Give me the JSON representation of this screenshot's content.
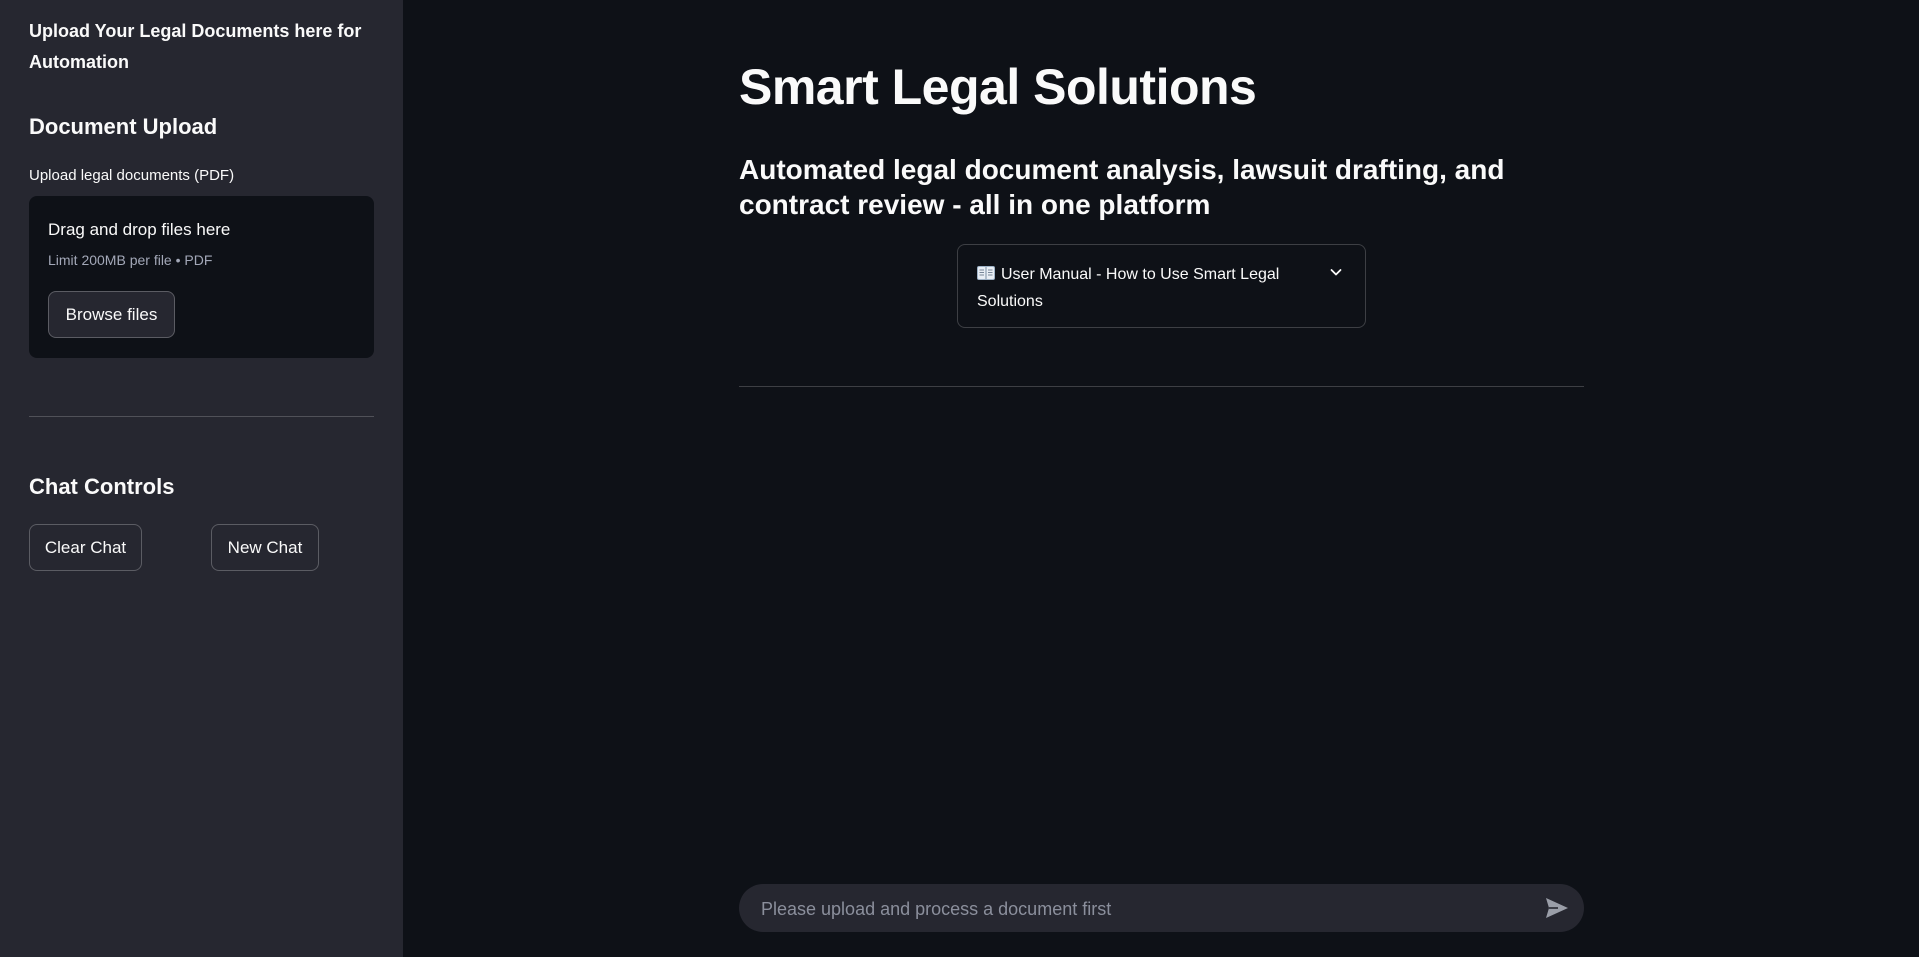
{
  "sidebar": {
    "tagline": "Upload Your Legal Documents here for Automation",
    "document_upload_heading": "Document Upload",
    "upload_label": "Upload legal documents (PDF)",
    "dropzone": {
      "title": "Drag and drop files here",
      "limit": "Limit 200MB per file • PDF",
      "browse_label": "Browse files"
    },
    "chat_controls_heading": "Chat Controls",
    "clear_chat_label": "Clear Chat",
    "new_chat_label": "New Chat"
  },
  "main": {
    "title": "Smart Legal Solutions",
    "subtitle": "Automated legal document analysis, lawsuit drafting, and contract review - all in one platform",
    "manual_expander": {
      "icon": "book-icon",
      "label": "User Manual - How to Use Smart Legal Solutions",
      "state": "collapsed"
    }
  },
  "chat_input": {
    "placeholder": "Please upload and process a document first",
    "value": "",
    "send_icon": "send-icon"
  },
  "colors": {
    "background": "#0e1117",
    "sidebar_background": "#262730",
    "text": "#fafafa",
    "muted_text": "#a3a8b8"
  }
}
